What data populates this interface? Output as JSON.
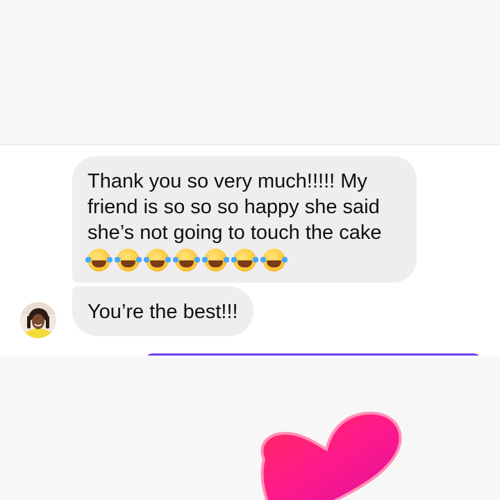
{
  "conversation": {
    "messages": [
      {
        "lines": [
          "Thank you so very much!!!!! My",
          "friend is so so so happy she said",
          "she’s not going to touch the cake"
        ],
        "emoji_icon": "face-with-tears-of-joy-icon",
        "emoji_count": 7
      },
      {
        "text": "You’re the best!!!"
      }
    ]
  },
  "colors": {
    "incoming_bubble": "#eeeef0",
    "accent": "#6f3cf0",
    "heart": "#ff1f7a"
  },
  "reaction": {
    "icon": "heart-icon"
  }
}
